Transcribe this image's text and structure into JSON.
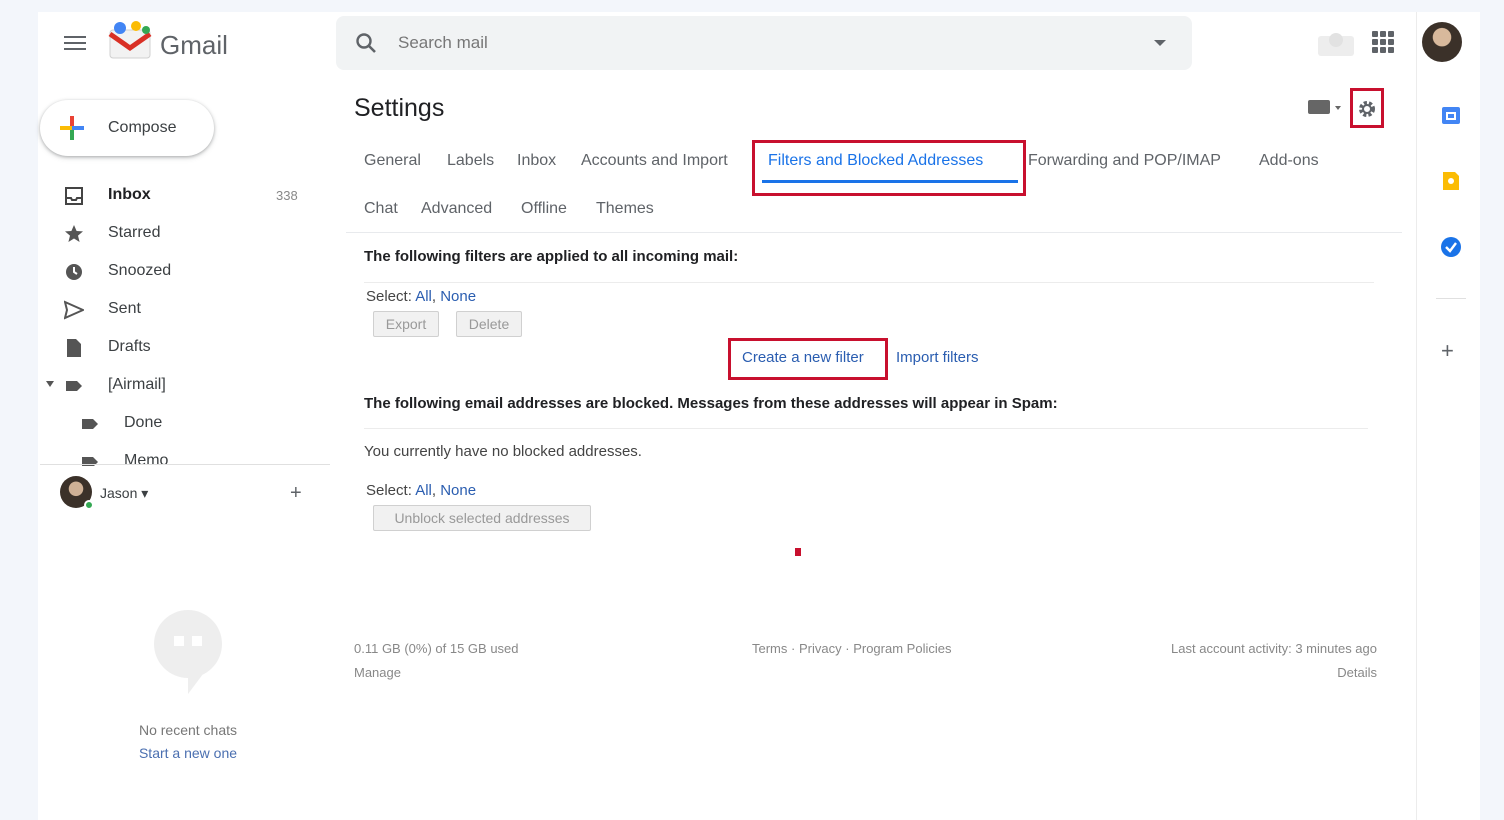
{
  "header": {
    "logo_text": "Gmail",
    "search_placeholder": "Search mail"
  },
  "sidebar": {
    "compose_label": "Compose",
    "items": [
      {
        "label": "Inbox",
        "count": "338"
      },
      {
        "label": "Starred"
      },
      {
        "label": "Snoozed"
      },
      {
        "label": "Sent"
      },
      {
        "label": "Drafts"
      },
      {
        "label": "[Airmail]"
      },
      {
        "label": "Done"
      },
      {
        "label": "Memo"
      }
    ],
    "user_name": "Jason",
    "no_chats": "No recent chats",
    "start_chat": "Start a new one"
  },
  "settings": {
    "title": "Settings",
    "tabs_row1": [
      "General",
      "Labels",
      "Inbox",
      "Accounts and Import",
      "Filters and Blocked Addresses",
      "Forwarding and POP/IMAP",
      "Add-ons"
    ],
    "tabs_row2": [
      "Chat",
      "Advanced",
      "Offline",
      "Themes"
    ],
    "filters_heading": "The following filters are applied to all incoming mail:",
    "select_label": "Select:",
    "select_all": "All",
    "select_none": "None",
    "export_button": "Export",
    "delete_button": "Delete",
    "create_filter": "Create a new filter",
    "import_filters": "Import filters",
    "blocked_heading": "The following email addresses are blocked. Messages from these addresses will appear in Spam:",
    "no_blocked": "You currently have no blocked addresses.",
    "unblock_button": "Unblock selected addresses"
  },
  "footer": {
    "storage": "0.11 GB (0%) of 15 GB used",
    "manage": "Manage",
    "terms": "Terms",
    "privacy": "Privacy",
    "policies": "Program Policies",
    "sep": "·",
    "activity": "Last account activity: 3 minutes ago",
    "details": "Details"
  },
  "colors": {
    "accent": "#1a73e8",
    "highlight": "#c8102e",
    "link": "#2a5db0"
  }
}
